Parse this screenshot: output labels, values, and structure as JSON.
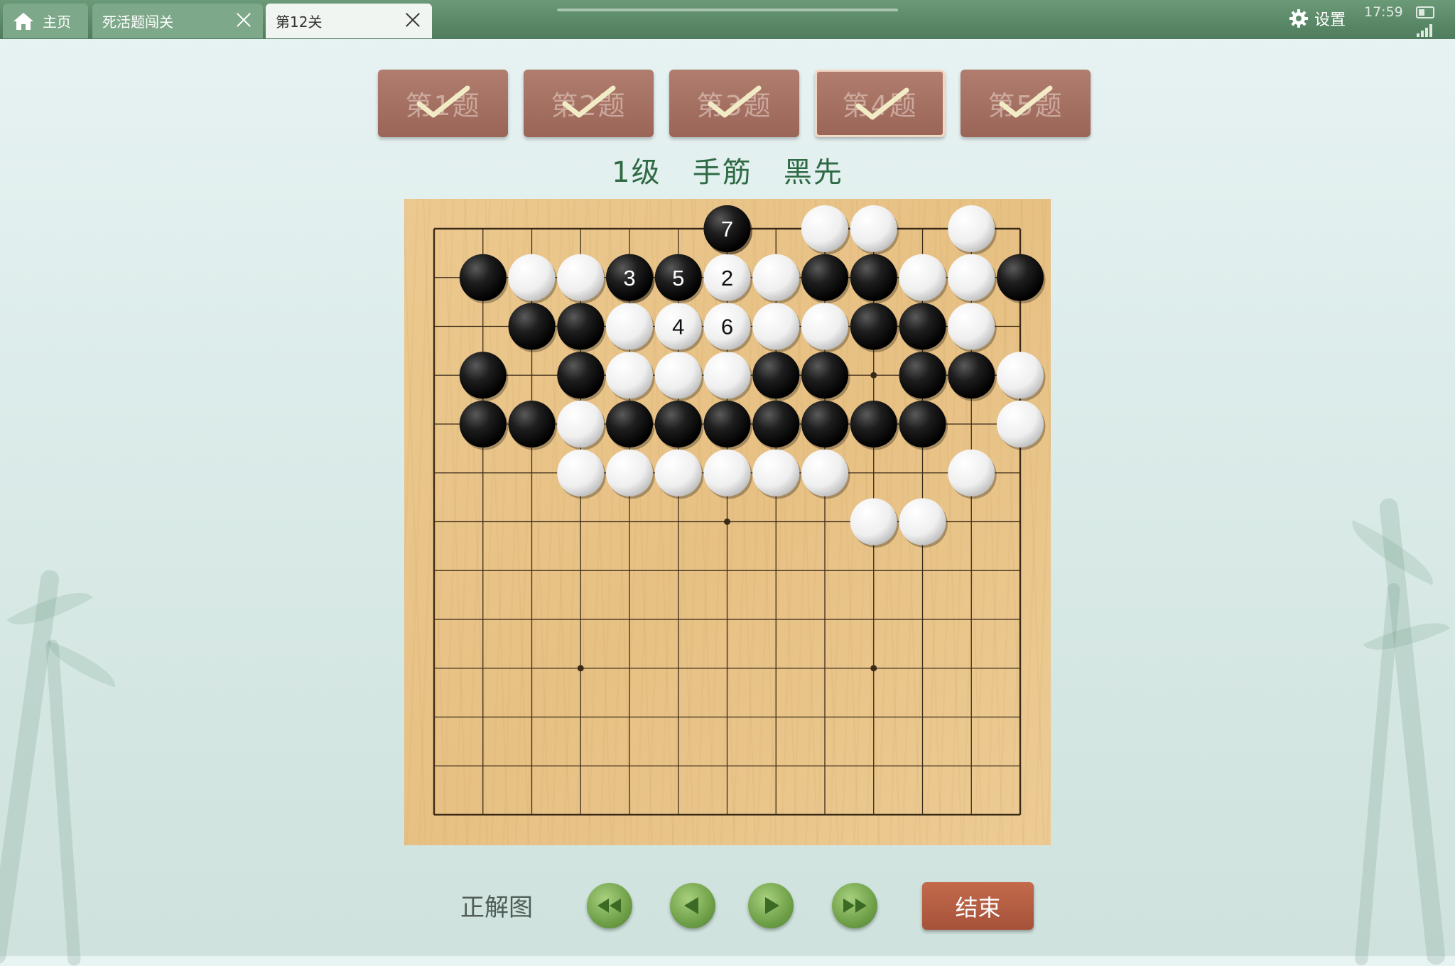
{
  "tabs": [
    {
      "label": "主页",
      "icon": "home-icon"
    },
    {
      "label": "死活题闯关",
      "closable": true
    },
    {
      "label": "第12关",
      "closable": true,
      "active": true
    }
  ],
  "status": {
    "settings_label": "设置",
    "time": "17:59"
  },
  "problems": [
    {
      "label": "第1题",
      "solved": true
    },
    {
      "label": "第2题",
      "solved": true
    },
    {
      "label": "第3题",
      "solved": true
    },
    {
      "label": "第4题",
      "solved": true,
      "active": true
    },
    {
      "label": "第5题",
      "solved": true
    }
  ],
  "problem_title": "1级   手筋   黑先",
  "board": {
    "size": 13,
    "star_points": [
      [
        3,
        3
      ],
      [
        3,
        9
      ],
      [
        6,
        6
      ],
      [
        9,
        3
      ],
      [
        9,
        9
      ]
    ],
    "black": [
      [
        6,
        0
      ],
      [
        1,
        1
      ],
      [
        4,
        1
      ],
      [
        8,
        1
      ],
      [
        9,
        1
      ],
      [
        12,
        1
      ],
      [
        2,
        2
      ],
      [
        3,
        2
      ],
      [
        9,
        2
      ],
      [
        10,
        2
      ],
      [
        1,
        3
      ],
      [
        3,
        3
      ],
      [
        7,
        3
      ],
      [
        8,
        3
      ],
      [
        10,
        3
      ],
      [
        11,
        3
      ],
      [
        1,
        4
      ],
      [
        2,
        4
      ],
      [
        4,
        4
      ],
      [
        5,
        4
      ],
      [
        6,
        4
      ],
      [
        7,
        4
      ],
      [
        8,
        4
      ],
      [
        9,
        4
      ],
      [
        10,
        4
      ]
    ],
    "white": [
      [
        8,
        0
      ],
      [
        9,
        0
      ],
      [
        11,
        0
      ],
      [
        2,
        1
      ],
      [
        3,
        1
      ],
      [
        7,
        1
      ],
      [
        10,
        1
      ],
      [
        11,
        1
      ],
      [
        4,
        2
      ],
      [
        7,
        2
      ],
      [
        8,
        2
      ],
      [
        11,
        2
      ],
      [
        4,
        3
      ],
      [
        5,
        3
      ],
      [
        6,
        3
      ],
      [
        12,
        3
      ],
      [
        3,
        4
      ],
      [
        12,
        4
      ],
      [
        3,
        5
      ],
      [
        4,
        5
      ],
      [
        5,
        5
      ],
      [
        6,
        5
      ],
      [
        7,
        5
      ],
      [
        8,
        5
      ],
      [
        11,
        5
      ],
      [
        9,
        6
      ],
      [
        10,
        6
      ]
    ],
    "numbered": [
      {
        "x": 6,
        "y": 1,
        "color": "white",
        "n": "2"
      },
      {
        "x": 4,
        "y": 1,
        "color": "black",
        "n": "3"
      },
      {
        "x": 5,
        "y": 2,
        "color": "white",
        "n": "4"
      },
      {
        "x": 5,
        "y": 1,
        "color": "black",
        "n": "5"
      },
      {
        "x": 6,
        "y": 2,
        "color": "white",
        "n": "6"
      },
      {
        "x": 6,
        "y": 0,
        "color": "black",
        "n": "7"
      }
    ]
  },
  "controls": {
    "solution_label": "正解图",
    "buttons": [
      "first-move",
      "previous-move",
      "next-move",
      "last-move"
    ],
    "end_label": "结束"
  }
}
